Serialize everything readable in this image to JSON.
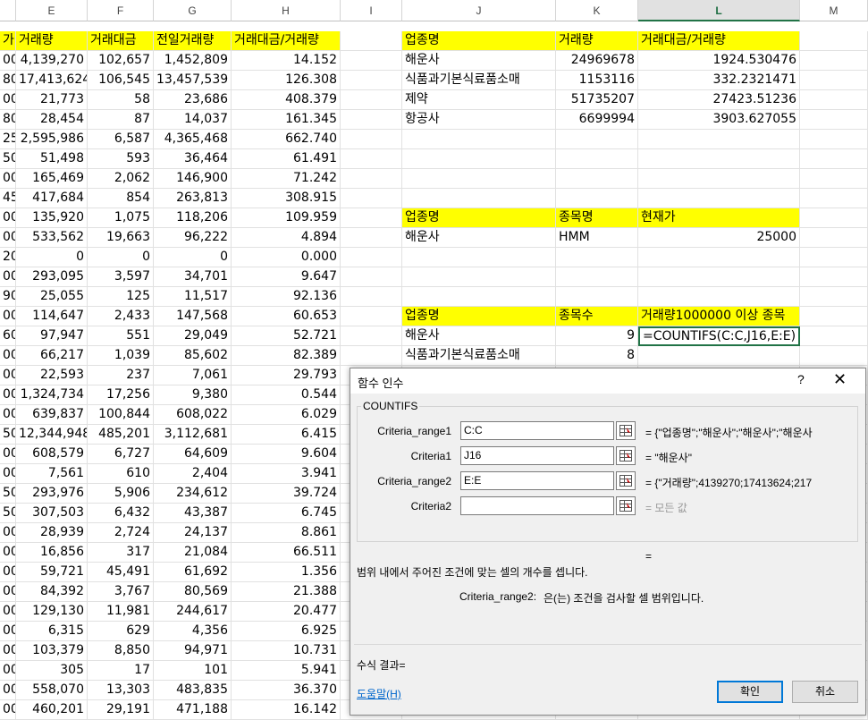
{
  "sheet": {
    "columns": [
      {
        "id": "D_end"
      },
      {
        "id": "E",
        "label": "E"
      },
      {
        "id": "F",
        "label": "F"
      },
      {
        "id": "G",
        "label": "G"
      },
      {
        "id": "H",
        "label": "H"
      },
      {
        "id": "I",
        "label": "I"
      },
      {
        "id": "J",
        "label": "J"
      },
      {
        "id": "K",
        "label": "K"
      },
      {
        "id": "L",
        "label": "L"
      },
      {
        "id": "M",
        "label": "M"
      }
    ],
    "rows": [
      [
        "가",
        "거래량",
        "거래대금",
        "전일거래량",
        "거래대금/거래량",
        "",
        "업종명",
        "거래량",
        "거래대금/거래량"
      ],
      [
        "00",
        "4,139,270",
        "102,657",
        "1,452,809",
        "14.152",
        "",
        "해운사",
        "24969678",
        "1924.530476"
      ],
      [
        "80",
        "17,413,624",
        "106,545",
        "13,457,539",
        "126.308",
        "",
        "식품과기본식료품소매",
        "1153116",
        "332.2321471"
      ],
      [
        "00",
        "21,773",
        "58",
        "23,686",
        "408.379",
        "",
        "제약",
        "51735207",
        "27423.51236"
      ],
      [
        "80",
        "28,454",
        "87",
        "14,037",
        "161.345",
        "",
        "항공사",
        "6699994",
        "3903.627055"
      ],
      [
        "25",
        "2,595,986",
        "6,587",
        "4,365,468",
        "662.740",
        "",
        "",
        "",
        ""
      ],
      [
        "50",
        "51,498",
        "593",
        "36,464",
        "61.491",
        "",
        "",
        "",
        ""
      ],
      [
        "00",
        "165,469",
        "2,062",
        "146,900",
        "71.242",
        "",
        "",
        "",
        ""
      ],
      [
        "45",
        "417,684",
        "854",
        "263,813",
        "308.915",
        "",
        "",
        "",
        ""
      ],
      [
        "00",
        "135,920",
        "1,075",
        "118,206",
        "109.959",
        "",
        "업종명",
        "종목명",
        "현재가"
      ],
      [
        "00",
        "533,562",
        "19,663",
        "96,222",
        "4.894",
        "",
        "해운사",
        "HMM",
        "25000"
      ],
      [
        "20",
        "0",
        "0",
        "0",
        "0.000",
        "",
        "",
        "",
        ""
      ],
      [
        "00",
        "293,095",
        "3,597",
        "34,701",
        "9.647",
        "",
        "",
        "",
        ""
      ],
      [
        "90",
        "25,055",
        "125",
        "11,517",
        "92.136",
        "",
        "",
        "",
        ""
      ],
      [
        "00",
        "114,647",
        "2,433",
        "147,568",
        "60.653",
        "",
        "업종명",
        "종목수",
        "거래량1000000 이상 종목"
      ],
      [
        "60",
        "97,947",
        "551",
        "29,049",
        "52.721",
        "",
        "해운사",
        "9",
        "=COUNTIFS(C:C,J16,E:E)"
      ],
      [
        "00",
        "66,217",
        "1,039",
        "85,602",
        "82.389",
        "",
        "식품과기본식료품소매",
        "8",
        ""
      ],
      [
        "00",
        "22,593",
        "237",
        "7,061",
        "29.793",
        "",
        "",
        "",
        ""
      ],
      [
        "00",
        "1,324,734",
        "17,256",
        "9,380",
        "0.544",
        "",
        "",
        "",
        ""
      ],
      [
        "00",
        "639,837",
        "100,844",
        "608,022",
        "6.029",
        "",
        "",
        "",
        ""
      ],
      [
        "50",
        "12,344,948",
        "485,201",
        "3,112,681",
        "6.415",
        "",
        "",
        "",
        ""
      ],
      [
        "00",
        "608,579",
        "6,727",
        "64,609",
        "9.604",
        "",
        "",
        "",
        ""
      ],
      [
        "00",
        "7,561",
        "610",
        "2,404",
        "3.941",
        "",
        "",
        "",
        ""
      ],
      [
        "50",
        "293,976",
        "5,906",
        "234,612",
        "39.724",
        "",
        "",
        "",
        ""
      ],
      [
        "50",
        "307,503",
        "6,432",
        "43,387",
        "6.745",
        "",
        "",
        "",
        ""
      ],
      [
        "00",
        "28,939",
        "2,724",
        "24,137",
        "8.861",
        "",
        "",
        "",
        ""
      ],
      [
        "00",
        "16,856",
        "317",
        "21,084",
        "66.511",
        "",
        "",
        "",
        ""
      ],
      [
        "00",
        "59,721",
        "45,491",
        "61,692",
        "1.356",
        "",
        "",
        "",
        ""
      ],
      [
        "00",
        "84,392",
        "3,767",
        "80,569",
        "21.388",
        "",
        "",
        "",
        ""
      ],
      [
        "00",
        "129,130",
        "11,981",
        "244,617",
        "20.477",
        "",
        "",
        "",
        ""
      ],
      [
        "00",
        "6,315",
        "629",
        "4,356",
        "6.925",
        "",
        "",
        "",
        ""
      ],
      [
        "00",
        "103,379",
        "8,850",
        "94,971",
        "10.731",
        "",
        "",
        "",
        ""
      ],
      [
        "00",
        "305",
        "17",
        "101",
        "5.941",
        "",
        "",
        "",
        ""
      ],
      [
        "00",
        "558,070",
        "13,303",
        "483,835",
        "36.370",
        "",
        "",
        "",
        ""
      ],
      [
        "00",
        "460,201",
        "29,191",
        "471,188",
        "16.142",
        "",
        "",
        "",
        ""
      ]
    ],
    "highlight_color": "#ffff00",
    "selected_column": "L"
  },
  "dialog": {
    "title": "함수 인수",
    "help_glyph": "?",
    "close_glyph": "✕",
    "function_name": "COUNTIFS",
    "args": [
      {
        "label": "Criteria_range1",
        "value": "C:C",
        "result": "= {\"업종명\";\"해운사\";\"해운사\";\"해운사"
      },
      {
        "label": "Criteria1",
        "value": "J16",
        "result": "= \"해운사\""
      },
      {
        "label": "Criteria_range2",
        "value": "E:E",
        "result": "= {\"거래량\";4139270;17413624;217"
      },
      {
        "label": "Criteria2",
        "value": "",
        "result": "= 모든 값"
      }
    ],
    "formula_eq": "=",
    "description": "범위 내에서 주어진 조건에 맞는 셀의 개수를 셉니다.",
    "arg_desc_name": "Criteria_range2:",
    "arg_desc_text": "은(는) 조건을 검사할 셀 범위입니다.",
    "result_label": "수식 결과=",
    "help_link": "도움말(H)",
    "ok_label": "확인",
    "cancel_label": "취소"
  }
}
